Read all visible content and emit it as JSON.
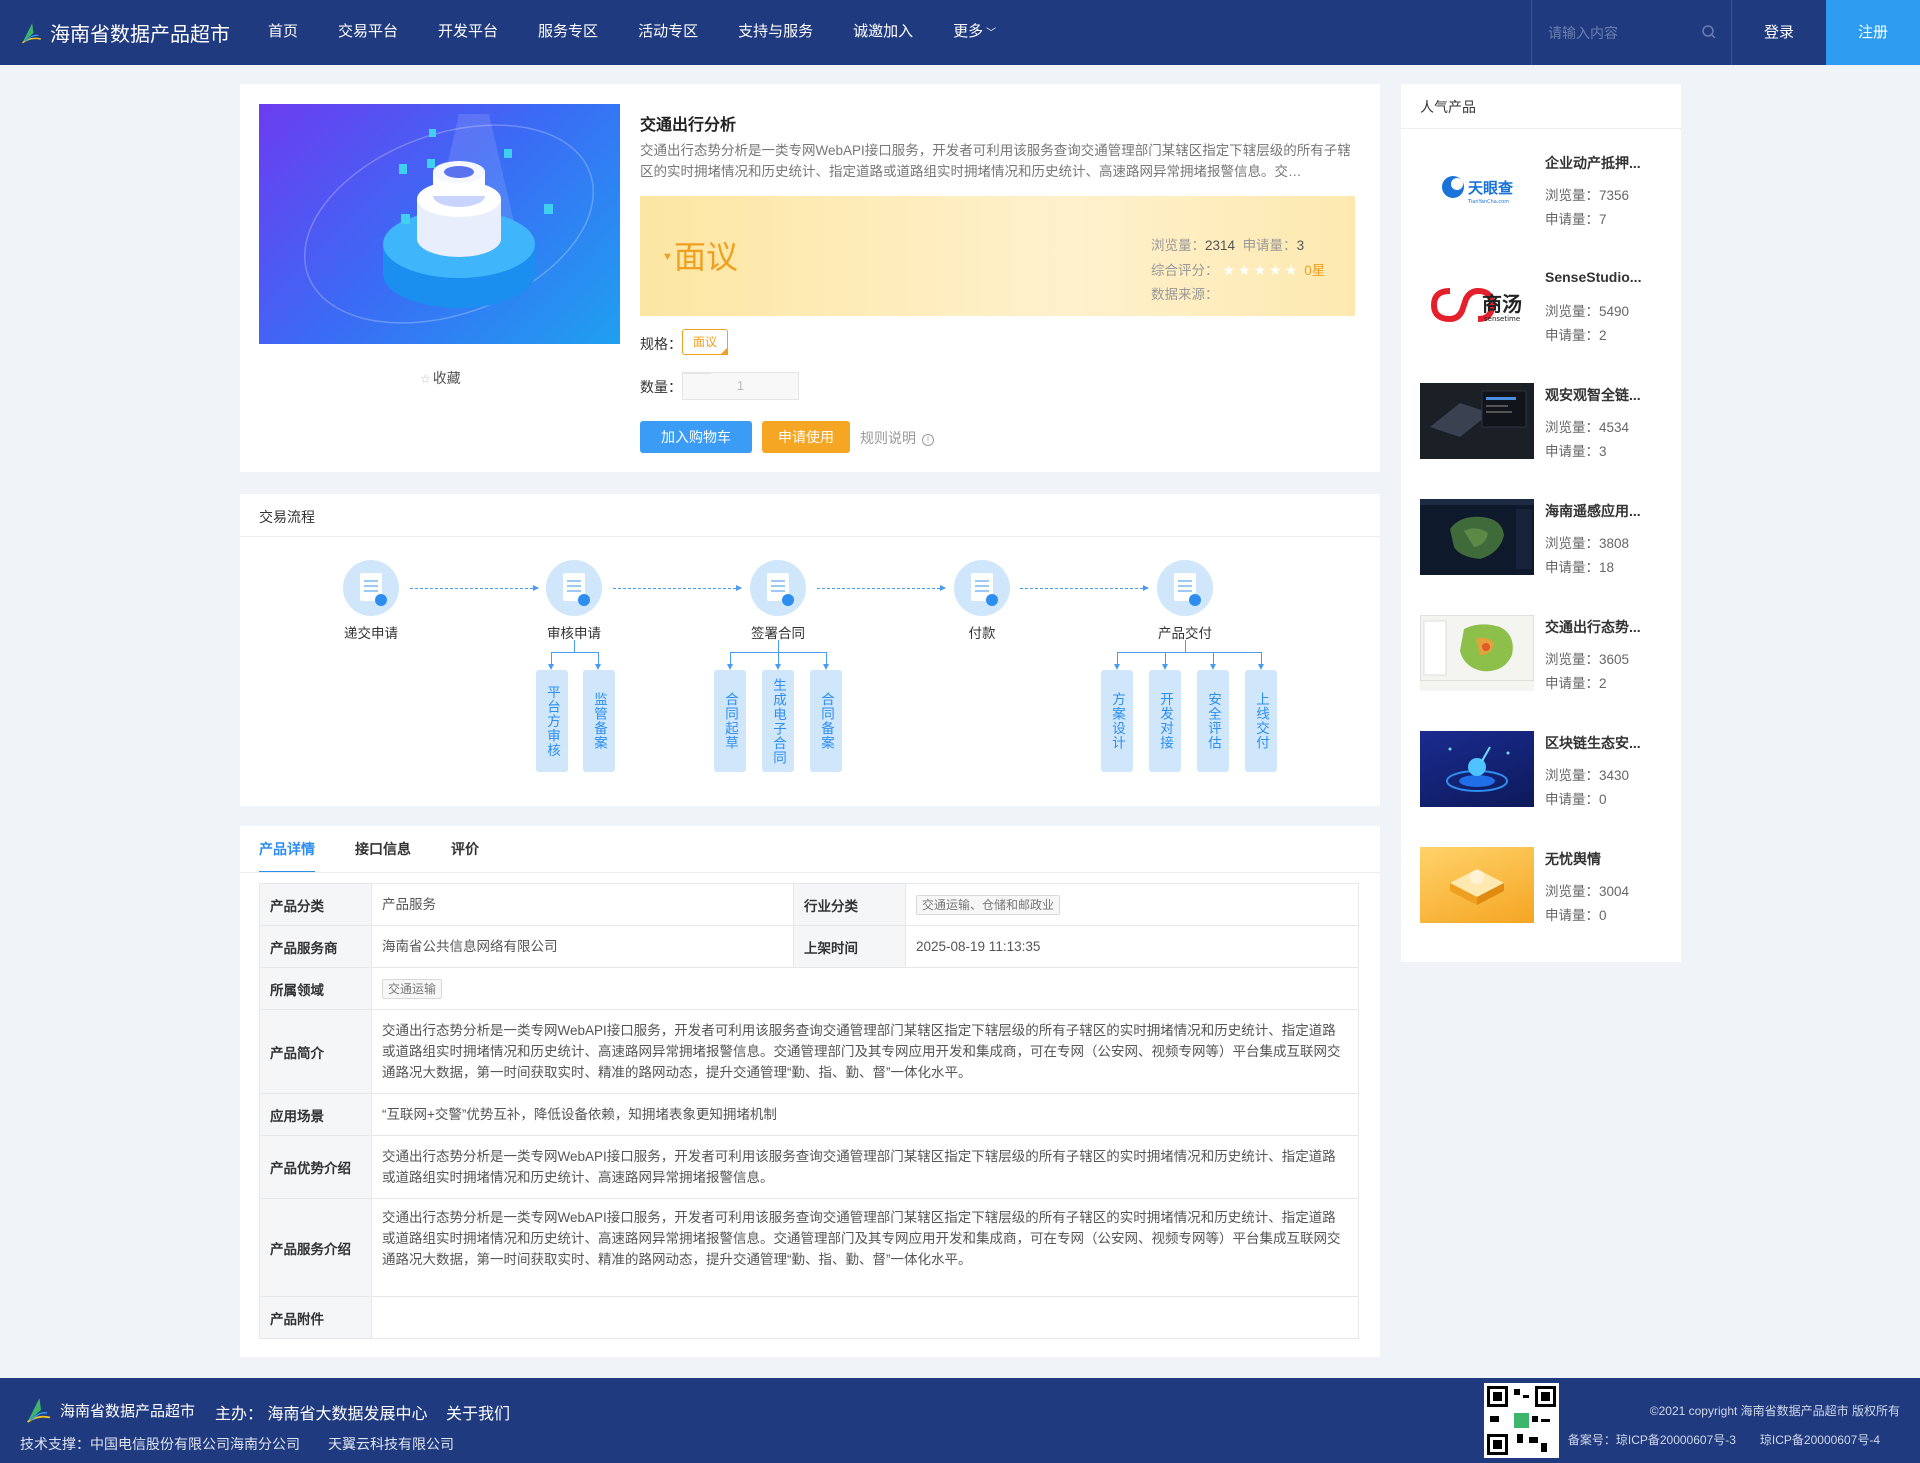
{
  "header": {
    "brand": "海南省数据产品超市",
    "nav": [
      "首页",
      "交易平台",
      "开发平台",
      "服务专区",
      "活动专区",
      "支持与服务",
      "诚邀加入",
      "更多"
    ],
    "search_placeholder": "请输入内容",
    "login": "登录",
    "register": "注册",
    "colors": {
      "bar": "#1f3a7f",
      "register": "#2d9cf0"
    }
  },
  "product": {
    "title": "交通出行分析",
    "description": "交通出行态势分析是一类专网WebAPI接口服务，开发者可利用该服务查询交通管理部门某辖区指定下辖层级的所有子辖区的实时拥堵情况和历史统计、指定道路或道路组实时拥堵情况和历史统计、高速路网异常拥堵报警信息。交…",
    "favorite": "收藏",
    "price": "面议",
    "views_label": "浏览量：",
    "views": "2314",
    "applies_label": "申请量：",
    "applies": "3",
    "rating_label": "综合评分：",
    "rating": "0星",
    "source_label": "数据来源：",
    "spec_label": "规格：",
    "spec_value": "面议",
    "qty_label": "数量：",
    "qty_value": "1",
    "add_cart": "加入购物车",
    "apply": "申请使用",
    "rules": "规则说明",
    "colors": {
      "cart": "#3a9cf5",
      "apply": "#f5a623",
      "price": "#f0a020"
    }
  },
  "flow": {
    "title": "交易流程",
    "steps": [
      "递交申请",
      "审核申请",
      "签署合同",
      "付款",
      "产品交付"
    ],
    "substeps": {
      "review": [
        "平台方审核",
        "监管备案"
      ],
      "contract": [
        "合同起草",
        "生成电子合同",
        "合同备案"
      ],
      "delivery": [
        "方案设计",
        "开发对接",
        "安全评估",
        "上线交付"
      ]
    }
  },
  "detail": {
    "tabs": [
      "产品详情",
      "接口信息",
      "评价"
    ],
    "rows": {
      "category_k": "产品分类",
      "category_v": "产品服务",
      "industry_k": "行业分类",
      "industry_v": "交通运输、仓储和邮政业",
      "provider_k": "产品服务商",
      "provider_v": "海南省公共信息网络有限公司",
      "shelf_k": "上架时间",
      "shelf_v": "2025-08-19 11:13:35",
      "domain_k": "所属领域",
      "domain_v": "交通运输",
      "intro_k": "产品简介",
      "intro_v": "交通出行态势分析是一类专网WebAPI接口服务，开发者可利用该服务查询交通管理部门某辖区指定下辖层级的所有子辖区的实时拥堵情况和历史统计、指定道路或道路组实时拥堵情况和历史统计、高速路网异常拥堵报警信息。交通管理部门及其专网应用开发和集成商，可在专网（公安网、视频专网等）平台集成互联网交通路况大数据，第一时间获取实时、精准的路网动态，提升交通管理“勤、指、勤、督”一体化水平。",
      "scene_k": "应用场景",
      "scene_v": "“互联网+交警”优势互补，降低设备依赖，知拥堵表象更知拥堵机制",
      "adv_k": "产品优势介绍",
      "adv_v": "交通出行态势分析是一类专网WebAPI接口服务，开发者可利用该服务查询交通管理部门某辖区指定下辖层级的所有子辖区的实时拥堵情况和历史统计、指定道路或道路组实时拥堵情况和历史统计、高速路网异常拥堵报警信息。",
      "svc_k": "产品服务介绍",
      "svc_v": "交通出行态势分析是一类专网WebAPI接口服务，开发者可利用该服务查询交通管理部门某辖区指定下辖层级的所有子辖区的实时拥堵情况和历史统计、指定道路或道路组实时拥堵情况和历史统计、高速路网异常拥堵报警信息。交通管理部门及其专网应用开发和集成商，可在专网（公安网、视频专网等）平台集成互联网交通路况大数据，第一时间获取实时、精准的路网动态，提升交通管理“勤、指、勤、督”一体化水平。",
      "attach_k": "产品附件"
    }
  },
  "sidebar": {
    "title": "人气产品",
    "views_label": "浏览量：",
    "applies_label": "申请量：",
    "items": [
      {
        "name": "企业动产抵押...",
        "views": "7356",
        "applies": "7",
        "logo_text": "天眼查",
        "logo_sub": "TianYanCha.com"
      },
      {
        "name": "SenseStudio...",
        "views": "5490",
        "applies": "2",
        "logo_text": "商汤",
        "logo_sub": "sensetime"
      },
      {
        "name": "观安观智全链...",
        "views": "4534",
        "applies": "3"
      },
      {
        "name": "海南遥感应用...",
        "views": "3808",
        "applies": "18"
      },
      {
        "name": "交通出行态势...",
        "views": "3605",
        "applies": "2"
      },
      {
        "name": "区块链生态安...",
        "views": "3430",
        "applies": "0"
      },
      {
        "name": "无忧舆情",
        "views": "3004",
        "applies": "0"
      }
    ]
  },
  "footer": {
    "brand": "海南省数据产品超市",
    "host": "主办： 海南省大数据发展中心",
    "about": "关于我们",
    "tech": "技术支撑：中国电信股份有限公司海南分公司　　天翼云科技有限公司",
    "copyright": "©2021 copyright 海南省数据产品超市 版权所有",
    "icp": "备案号：琼ICP备20000607号-3　　琼ICP备20000607号-4"
  }
}
